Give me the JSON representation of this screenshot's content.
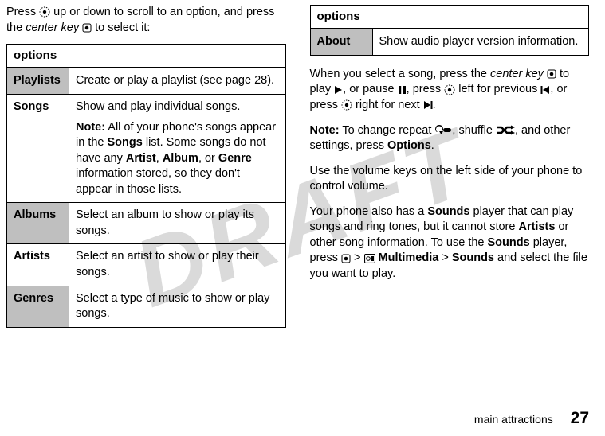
{
  "watermark": "DRAFT",
  "left": {
    "intro_pre": "Press ",
    "intro_mid": " up or down to scroll to an option, and press the ",
    "intro_key": "center key",
    "intro_post": " to select it:",
    "table_header": "options",
    "rows": {
      "playlists": {
        "label": "Playlists",
        "desc": "Create or play a playlist (see page 28)."
      },
      "songs": {
        "label": "Songs",
        "desc1": "Show and play individual songs.",
        "note_label": "Note:",
        "note_pre": " All of your phone's songs appear in the ",
        "songs_word": "Songs",
        "note_mid1": " list. Some songs do not have any ",
        "artist_word": "Artist",
        "comma1": ", ",
        "album_word": "Album",
        "or": ", or ",
        "genre_word": "Genre",
        "note_post": " information stored, so they don't appear in those lists."
      },
      "albums": {
        "label": "Albums",
        "desc": "Select an album to show or play its songs."
      },
      "artists": {
        "label": "Artists",
        "desc": "Select an artist to show or play their songs."
      },
      "genres": {
        "label": "Genres",
        "desc": "Select a type of music to show or play songs."
      }
    }
  },
  "right": {
    "table_header": "options",
    "about": {
      "label": "About",
      "desc": "Show audio player version information."
    },
    "p1_a": "When you select a song, press the ",
    "p1_key": "center key",
    "p1_b": " to play ",
    "p1_c": ", or pause ",
    "p1_d": ", press ",
    "p1_e": " left for previous ",
    "p1_f": ", or press ",
    "p1_g": " right for next ",
    "p1_h": ".",
    "p2_note": "Note:",
    "p2_a": " To change repeat ",
    "p2_b": ", shuffle ",
    "p2_c": ", and other settings, press ",
    "p2_options": "Options",
    "p2_d": ".",
    "p3": "Use the volume keys on the left side of your phone to control volume.",
    "p4_a": "Your phone also has a ",
    "p4_sounds": "Sounds",
    "p4_b": " player that can play songs and ring tones, but it cannot store ",
    "p4_artists": "Artists",
    "p4_c": " or other song information. To use the ",
    "p4_d": " player, press ",
    "p4_gt1": " > ",
    "p4_mm": " Multimedia",
    "p4_gt2": " > ",
    "p4_e": " and select the file you want to play."
  },
  "footer": {
    "section": "main attractions",
    "page": "27"
  }
}
